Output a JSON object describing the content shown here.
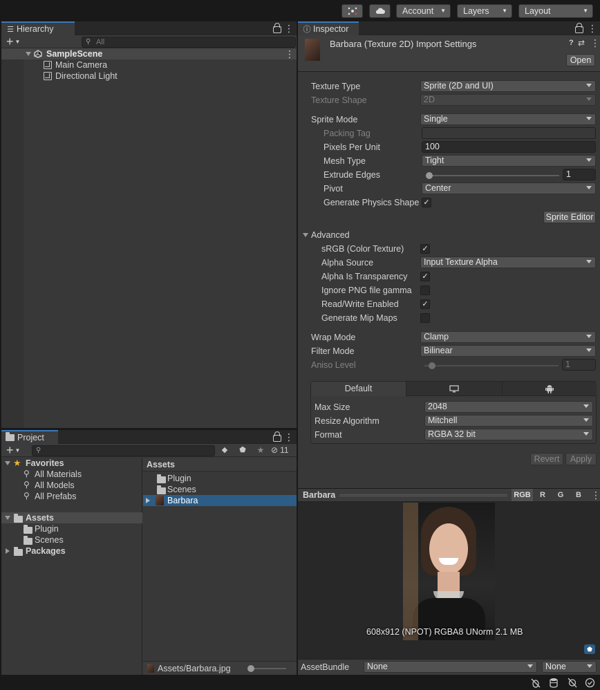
{
  "toolbar": {
    "collab_icon": "collab-icon",
    "cloud_icon": "cloud-icon",
    "account": "Account",
    "layers": "Layers",
    "layout": "Layout"
  },
  "hierarchy": {
    "tab": "Hierarchy",
    "search_placeholder": "All",
    "scene": "SampleScene",
    "items": [
      "Main Camera",
      "Directional Light"
    ]
  },
  "project": {
    "tab": "Project",
    "hidden_count": "11",
    "favorites": {
      "label": "Favorites",
      "items": [
        "All Materials",
        "All Models",
        "All Prefabs"
      ]
    },
    "tree": {
      "assets": "Assets",
      "children": [
        "Plugin",
        "Scenes"
      ],
      "packages": "Packages"
    },
    "breadcrumb": "Assets",
    "files": [
      "Plugin",
      "Scenes",
      "Barbara"
    ],
    "selected_path": "Assets/Barbara.jpg"
  },
  "inspector": {
    "tab": "Inspector",
    "title": "Barbara (Texture 2D) Import Settings",
    "open_button": "Open",
    "texture_type": {
      "label": "Texture Type",
      "value": "Sprite (2D and UI)"
    },
    "texture_shape": {
      "label": "Texture Shape",
      "value": "2D"
    },
    "sprite_mode": {
      "label": "Sprite Mode",
      "value": "Single"
    },
    "packing_tag": {
      "label": "Packing Tag",
      "value": ""
    },
    "pixels_per_unit": {
      "label": "Pixels Per Unit",
      "value": "100"
    },
    "mesh_type": {
      "label": "Mesh Type",
      "value": "Tight"
    },
    "extrude_edges": {
      "label": "Extrude Edges",
      "value": "1"
    },
    "pivot": {
      "label": "Pivot",
      "value": "Center"
    },
    "generate_physics_shape": {
      "label": "Generate Physics Shape",
      "checked": true
    },
    "sprite_editor_button": "Sprite Editor",
    "advanced": {
      "label": "Advanced",
      "srgb": {
        "label": "sRGB (Color Texture)",
        "checked": true
      },
      "alpha_source": {
        "label": "Alpha Source",
        "value": "Input Texture Alpha"
      },
      "alpha_is_transparency": {
        "label": "Alpha Is Transparency",
        "checked": true
      },
      "ignore_png_gamma": {
        "label": "Ignore PNG file gamma",
        "checked": false
      },
      "read_write": {
        "label": "Read/Write Enabled",
        "checked": true
      },
      "mip_maps": {
        "label": "Generate Mip Maps",
        "checked": false
      }
    },
    "wrap_mode": {
      "label": "Wrap Mode",
      "value": "Clamp"
    },
    "filter_mode": {
      "label": "Filter Mode",
      "value": "Bilinear"
    },
    "aniso_level": {
      "label": "Aniso Level",
      "value": "1"
    },
    "platform_tabs": [
      "Default",
      "monitor-icon",
      "android-icon"
    ],
    "max_size": {
      "label": "Max Size",
      "value": "2048"
    },
    "resize_algorithm": {
      "label": "Resize Algorithm",
      "value": "Mitchell"
    },
    "format": {
      "label": "Format",
      "value": "RGBA 32 bit"
    },
    "revert_button": "Revert",
    "apply_button": "Apply"
  },
  "preview": {
    "title": "Barbara",
    "channels": [
      "RGB",
      "R",
      "G",
      "B"
    ],
    "info": "608x912 (NPOT)  RGBA8 UNorm   2.1 MB"
  },
  "assetbundle": {
    "label": "AssetBundle",
    "name": "None",
    "variant": "None"
  }
}
